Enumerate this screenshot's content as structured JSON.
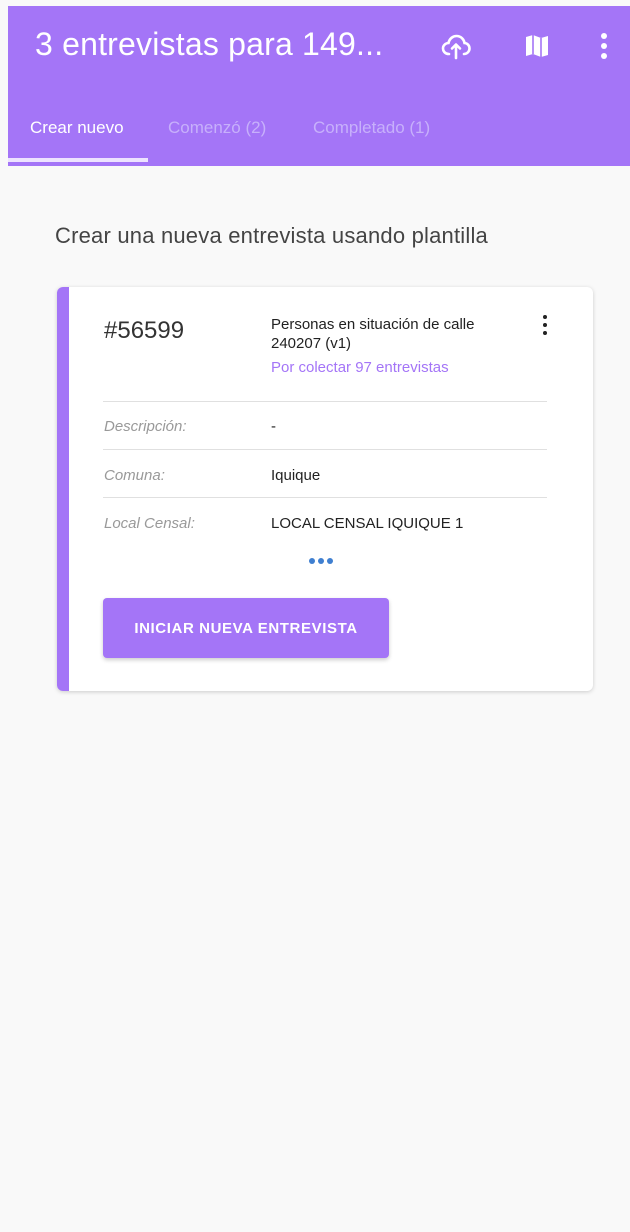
{
  "appbar": {
    "title": "3 entrevistas para 149...",
    "icons": [
      "cloud-sync-icon",
      "map-icon",
      "more-vert-icon"
    ],
    "tabs": [
      {
        "label": "Crear nuevo",
        "active": true
      },
      {
        "label": "Comenzó (2)",
        "active": false
      },
      {
        "label": "Completado (1)",
        "active": false
      }
    ]
  },
  "main": {
    "heading": "Crear una nueva entrevista usando plantilla",
    "card": {
      "id": "#56599",
      "name": "Personas en situación de calle 240207 (v1)",
      "subtitle": "Por colectar 97 entrevistas",
      "rows": [
        {
          "label": "Descripción:",
          "value": "-"
        },
        {
          "label": "Comuna:",
          "value": "Iquique"
        },
        {
          "label": "Local Censal:",
          "value": "LOCAL CENSAL IQUIQUE 1"
        }
      ],
      "button_label": "INICIAR NUEVA ENTREVISTA"
    }
  },
  "colors": {
    "primary": "#a475f7",
    "background": "#f9f9f9",
    "link_dots": "#3f7fd0"
  }
}
